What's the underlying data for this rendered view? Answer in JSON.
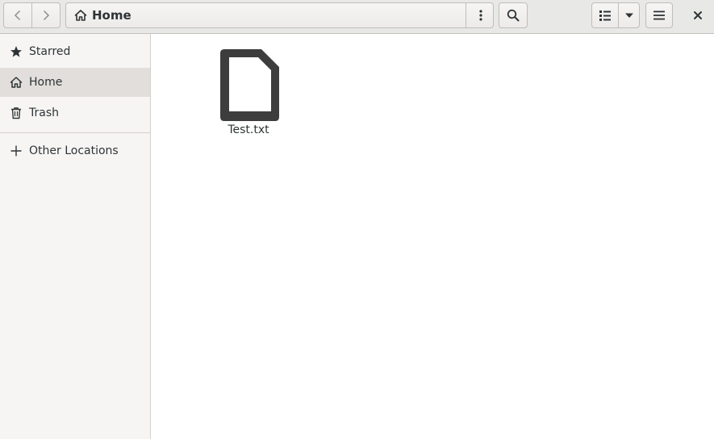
{
  "header": {
    "path_label": "Home",
    "icons": {
      "back": "go-previous-icon",
      "forward": "go-next-icon",
      "home": "home-icon",
      "path_menu": "vertical-dots-icon",
      "search": "search-icon",
      "view_list": "list-view-icon",
      "view_options": "dropdown-arrow-icon",
      "main_menu": "hamburger-icon",
      "close": "close-icon"
    }
  },
  "sidebar": {
    "items": [
      {
        "label": "Starred",
        "icon": "star-icon"
      },
      {
        "label": "Home",
        "icon": "home-icon",
        "active": true
      },
      {
        "label": "Trash",
        "icon": "trash-icon"
      },
      {
        "label": "Other Locations",
        "icon": "plus-icon"
      }
    ]
  },
  "files": [
    {
      "name": "Test.txt",
      "icon": "text-file-icon"
    }
  ],
  "colors": {
    "headerbar": "#e8e8e7",
    "sidebar": "#f6f5f4",
    "sidebar_active": "#e1dedb",
    "text": "#2e3436",
    "file_icon": "#3d3d3d"
  }
}
